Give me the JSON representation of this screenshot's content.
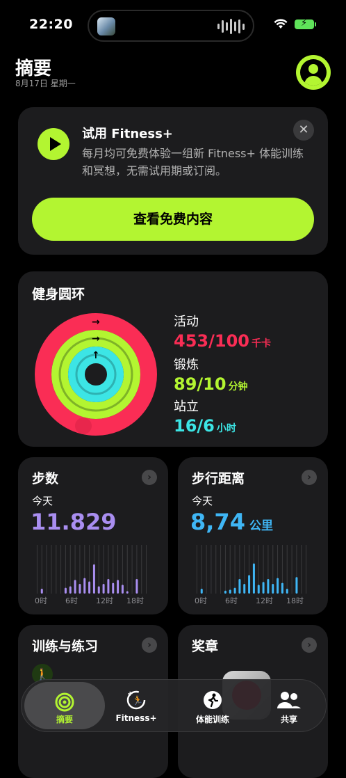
{
  "status_bar": {
    "time": "22:20"
  },
  "header": {
    "title": "摘要",
    "date": "8月17日 星期一"
  },
  "promo": {
    "title": "试用 Fitness+",
    "description": "每月均可免费体验一组新 Fitness+ 体能训练和冥想，无需试用期或订阅。",
    "cta": "查看免费内容"
  },
  "rings": {
    "title": "健身圆环",
    "move": {
      "label": "活动",
      "value": "453/100",
      "unit": "千卡",
      "color": "#fa2d55",
      "progress": 4.53
    },
    "exercise": {
      "label": "锻炼",
      "value": "89/10",
      "unit": "分钟",
      "color": "#b3f531",
      "progress": 8.9
    },
    "stand": {
      "label": "站立",
      "value": "16/6",
      "unit": "小时",
      "color": "#3ce5e5",
      "progress": 2.67
    }
  },
  "steps": {
    "title": "步数",
    "today": "今天",
    "value": "11.829",
    "color": "#a98ef0"
  },
  "distance": {
    "title": "步行距离",
    "today": "今天",
    "value": "8,74",
    "unit": "公里",
    "color": "#3fb6f5"
  },
  "chart_axis": [
    "0时",
    "6时",
    "12时",
    "18时"
  ],
  "workouts": {
    "title": "训练与练习"
  },
  "awards": {
    "title": "奖章"
  },
  "tabs": [
    {
      "label": "摘要"
    },
    {
      "label": "Fitness+"
    },
    {
      "label": "体能训练"
    },
    {
      "label": "共享"
    }
  ],
  "chart_data": [
    {
      "type": "bar",
      "title": "步数",
      "x": [
        0,
        1,
        2,
        3,
        4,
        5,
        6,
        7,
        8,
        9,
        10,
        11,
        12,
        13,
        14,
        15,
        16,
        17,
        18,
        19,
        20,
        21,
        22,
        23
      ],
      "values": [
        0,
        0.1,
        0,
        0,
        0,
        0,
        0.12,
        0.15,
        0.28,
        0.2,
        0.32,
        0.25,
        0.6,
        0.15,
        0.2,
        0.3,
        0.22,
        0.28,
        0.18,
        0.05,
        0,
        0.3,
        0,
        0
      ],
      "xlabel": "",
      "ylabel": ""
    },
    {
      "type": "bar",
      "title": "步行距离",
      "x": [
        0,
        1,
        2,
        3,
        4,
        5,
        6,
        7,
        8,
        9,
        10,
        11,
        12,
        13,
        14,
        15,
        16,
        17,
        18,
        19,
        20,
        21,
        22,
        23
      ],
      "values": [
        0,
        0.1,
        0,
        0,
        0,
        0,
        0.06,
        0.08,
        0.12,
        0.3,
        0.2,
        0.38,
        0.62,
        0.18,
        0.24,
        0.3,
        0.2,
        0.32,
        0.22,
        0.1,
        0,
        0.34,
        0,
        0
      ],
      "xlabel": "",
      "ylabel": ""
    }
  ]
}
